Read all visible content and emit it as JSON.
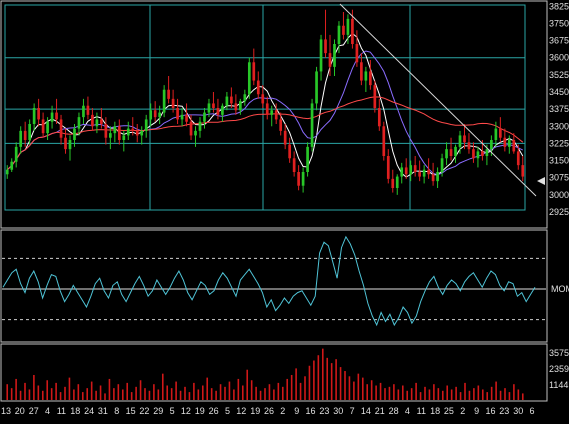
{
  "chart_data": [
    {
      "panel": "price",
      "type": "candlestick",
      "y_ticks": [
        3825,
        3750,
        3675,
        3600,
        3525,
        3450,
        3375,
        3300,
        3225,
        3150,
        3075,
        3000,
        2925
      ],
      "ylim": [
        2925,
        3835
      ],
      "grid": true,
      "last_price_marker": 3085,
      "candles": [
        [
          3090,
          3130,
          3070,
          3110
        ],
        [
          3110,
          3160,
          3100,
          3145
        ],
        [
          3145,
          3230,
          3120,
          3210
        ],
        [
          3210,
          3300,
          3180,
          3280
        ],
        [
          3280,
          3320,
          3210,
          3240
        ],
        [
          3240,
          3330,
          3220,
          3310
        ],
        [
          3310,
          3400,
          3280,
          3380
        ],
        [
          3380,
          3420,
          3300,
          3330
        ],
        [
          3330,
          3360,
          3250,
          3270
        ],
        [
          3270,
          3340,
          3240,
          3320
        ],
        [
          3320,
          3390,
          3290,
          3360
        ],
        [
          3360,
          3420,
          3310,
          3330
        ],
        [
          3330,
          3350,
          3220,
          3250
        ],
        [
          3250,
          3290,
          3180,
          3200
        ],
        [
          3200,
          3260,
          3150,
          3240
        ],
        [
          3240,
          3310,
          3210,
          3290
        ],
        [
          3290,
          3360,
          3260,
          3340
        ],
        [
          3340,
          3420,
          3310,
          3390
        ],
        [
          3390,
          3430,
          3330,
          3350
        ],
        [
          3350,
          3380,
          3280,
          3300
        ],
        [
          3300,
          3360,
          3270,
          3330
        ],
        [
          3330,
          3380,
          3290,
          3310
        ],
        [
          3310,
          3340,
          3220,
          3250
        ],
        [
          3250,
          3300,
          3200,
          3270
        ],
        [
          3270,
          3320,
          3230,
          3300
        ],
        [
          3300,
          3330,
          3220,
          3240
        ],
        [
          3240,
          3280,
          3190,
          3260
        ],
        [
          3260,
          3320,
          3240,
          3290
        ],
        [
          3290,
          3340,
          3260,
          3280
        ],
        [
          3280,
          3310,
          3230,
          3260
        ],
        [
          3260,
          3300,
          3220,
          3280
        ],
        [
          3280,
          3350,
          3250,
          3330
        ],
        [
          3330,
          3400,
          3300,
          3370
        ],
        [
          3370,
          3410,
          3320,
          3340
        ],
        [
          3340,
          3390,
          3310,
          3360
        ],
        [
          3360,
          3480,
          3340,
          3460
        ],
        [
          3460,
          3520,
          3400,
          3420
        ],
        [
          3420,
          3460,
          3360,
          3380
        ],
        [
          3380,
          3420,
          3310,
          3330
        ],
        [
          3330,
          3380,
          3300,
          3350
        ],
        [
          3350,
          3400,
          3300,
          3320
        ],
        [
          3320,
          3350,
          3240,
          3260
        ],
        [
          3260,
          3300,
          3210,
          3280
        ],
        [
          3280,
          3340,
          3250,
          3320
        ],
        [
          3320,
          3380,
          3290,
          3360
        ],
        [
          3360,
          3420,
          3340,
          3400
        ],
        [
          3400,
          3450,
          3360,
          3380
        ],
        [
          3380,
          3420,
          3330,
          3350
        ],
        [
          3350,
          3400,
          3320,
          3390
        ],
        [
          3390,
          3450,
          3370,
          3430
        ],
        [
          3430,
          3470,
          3380,
          3400
        ],
        [
          3400,
          3440,
          3350,
          3370
        ],
        [
          3370,
          3420,
          3350,
          3410
        ],
        [
          3410,
          3460,
          3390,
          3440
        ],
        [
          3440,
          3600,
          3420,
          3580
        ],
        [
          3580,
          3640,
          3480,
          3500
        ],
        [
          3500,
          3540,
          3420,
          3440
        ],
        [
          3440,
          3480,
          3380,
          3400
        ],
        [
          3400,
          3430,
          3330,
          3350
        ],
        [
          3350,
          3390,
          3300,
          3370
        ],
        [
          3370,
          3400,
          3310,
          3330
        ],
        [
          3330,
          3360,
          3260,
          3280
        ],
        [
          3280,
          3310,
          3200,
          3220
        ],
        [
          3220,
          3250,
          3140,
          3160
        ],
        [
          3160,
          3190,
          3080,
          3100
        ],
        [
          3100,
          3130,
          3020,
          3040
        ],
        [
          3040,
          3120,
          3010,
          3100
        ],
        [
          3100,
          3230,
          3080,
          3210
        ],
        [
          3210,
          3420,
          3190,
          3400
        ],
        [
          3400,
          3560,
          3370,
          3540
        ],
        [
          3540,
          3700,
          3500,
          3680
        ],
        [
          3680,
          3810,
          3600,
          3620
        ],
        [
          3620,
          3700,
          3520,
          3560
        ],
        [
          3560,
          3680,
          3520,
          3660
        ],
        [
          3660,
          3760,
          3620,
          3740
        ],
        [
          3740,
          3800,
          3680,
          3700
        ],
        [
          3700,
          3790,
          3660,
          3770
        ],
        [
          3770,
          3810,
          3640,
          3660
        ],
        [
          3660,
          3720,
          3560,
          3580
        ],
        [
          3580,
          3620,
          3480,
          3500
        ],
        [
          3500,
          3560,
          3450,
          3540
        ],
        [
          3540,
          3590,
          3460,
          3480
        ],
        [
          3480,
          3500,
          3360,
          3380
        ],
        [
          3380,
          3420,
          3280,
          3300
        ],
        [
          3300,
          3320,
          3150,
          3170
        ],
        [
          3170,
          3200,
          3050,
          3070
        ],
        [
          3070,
          3110,
          3010,
          3030
        ],
        [
          3030,
          3090,
          3000,
          3080
        ],
        [
          3080,
          3140,
          3050,
          3120
        ],
        [
          3120,
          3160,
          3070,
          3090
        ],
        [
          3090,
          3150,
          3060,
          3130
        ],
        [
          3130,
          3170,
          3080,
          3100
        ],
        [
          3100,
          3150,
          3060,
          3080
        ],
        [
          3080,
          3130,
          3050,
          3110
        ],
        [
          3110,
          3160,
          3070,
          3090
        ],
        [
          3090,
          3140,
          3040,
          3060
        ],
        [
          3060,
          3120,
          3030,
          3100
        ],
        [
          3100,
          3180,
          3080,
          3160
        ],
        [
          3160,
          3230,
          3130,
          3200
        ],
        [
          3200,
          3250,
          3150,
          3170
        ],
        [
          3170,
          3220,
          3140,
          3210
        ],
        [
          3210,
          3280,
          3180,
          3260
        ],
        [
          3260,
          3310,
          3200,
          3230
        ],
        [
          3230,
          3270,
          3180,
          3200
        ],
        [
          3200,
          3230,
          3140,
          3160
        ],
        [
          3160,
          3210,
          3120,
          3190
        ],
        [
          3190,
          3240,
          3150,
          3170
        ],
        [
          3170,
          3220,
          3130,
          3200
        ],
        [
          3200,
          3260,
          3170,
          3240
        ],
        [
          3240,
          3320,
          3210,
          3290
        ],
        [
          3290,
          3340,
          3230,
          3250
        ],
        [
          3250,
          3290,
          3190,
          3210
        ],
        [
          3210,
          3260,
          3180,
          3240
        ],
        [
          3240,
          3270,
          3180,
          3190
        ],
        [
          3190,
          3220,
          3110,
          3130
        ],
        [
          3130,
          3170,
          3060,
          3080
        ]
      ]
    },
    {
      "panel": "momentum",
      "type": "line",
      "label": "MOM",
      "series": [
        2,
        10,
        18,
        22,
        6,
        -4,
        12,
        20,
        8,
        -10,
        4,
        16,
        14,
        -2,
        -14,
        -6,
        4,
        -4,
        -12,
        -20,
        -8,
        6,
        12,
        -2,
        -10,
        4,
        8,
        -6,
        -14,
        -4,
        6,
        14,
        4,
        -8,
        -2,
        10,
        2,
        -6,
        2,
        12,
        20,
        10,
        -4,
        -12,
        -2,
        8,
        4,
        -6,
        -2,
        10,
        18,
        12,
        2,
        -8,
        10,
        16,
        22,
        14,
        6,
        -4,
        -20,
        -12,
        -24,
        -18,
        -10,
        -16,
        -8,
        -4,
        -2,
        -10,
        -18,
        -8,
        40,
        52,
        48,
        30,
        12,
        46,
        58,
        50,
        38,
        20,
        4,
        -16,
        -30,
        -40,
        -26,
        -36,
        -28,
        -40,
        -32,
        -20,
        -26,
        -38,
        -30,
        -14,
        -2,
        8,
        14,
        2,
        -6,
        4,
        10,
        6,
        -2,
        8,
        14,
        18,
        10,
        2,
        12,
        20,
        16,
        4,
        -2,
        8,
        6,
        -8,
        -4,
        -14,
        -6,
        2
      ],
      "dashed_levels": [
        34,
        -34
      ],
      "zero_line": 0
    },
    {
      "panel": "volume",
      "type": "bar",
      "y_ticks": [
        3575,
        2359,
        1144
      ],
      "ylim": [
        0,
        4100
      ],
      "values": [
        1200,
        900,
        1600,
        700,
        1300,
        800,
        1900,
        1100,
        700,
        1500,
        900,
        1300,
        600,
        1000,
        1700,
        800,
        1200,
        600,
        900,
        1400,
        700,
        1100,
        500,
        1600,
        900,
        1200,
        800,
        1300,
        600,
        1000,
        1500,
        900,
        700,
        1200,
        800,
        2000,
        1100,
        900,
        1400,
        700,
        1000,
        600,
        1300,
        800,
        1100,
        1700,
        900,
        700,
        1200,
        1000,
        1400,
        800,
        1600,
        1100,
        2300,
        1500,
        1000,
        700,
        900,
        1200,
        800,
        1300,
        1000,
        1600,
        1900,
        2400,
        1300,
        1800,
        2600,
        3000,
        3400,
        3900,
        3200,
        2800,
        3100,
        2500,
        2200,
        1800,
        1400,
        2000,
        1700,
        1200,
        1500,
        1100,
        1300,
        900,
        1000,
        1200,
        800,
        1100,
        700,
        900,
        1300,
        600,
        1000,
        800,
        1200,
        900,
        700,
        1100,
        800,
        1000,
        600,
        1300,
        700,
        900,
        1100,
        800,
        600,
        1000,
        1400,
        700,
        900,
        600,
        1200,
        800,
        500
      ]
    },
    {
      "panel": "x_axis",
      "type": "axis",
      "date_labels": [
        "13",
        "20",
        "27",
        "4",
        "11",
        "18",
        "24",
        "31",
        "8",
        "15",
        "22",
        "29",
        "5",
        "12",
        "19",
        "26",
        "5",
        "12",
        "19",
        "26",
        "2",
        "9",
        "16",
        "23",
        "30",
        "7",
        "14",
        "21",
        "28",
        "4",
        "11",
        "18",
        "25",
        "2",
        "9",
        "16",
        "23",
        "30",
        "6"
      ]
    }
  ]
}
